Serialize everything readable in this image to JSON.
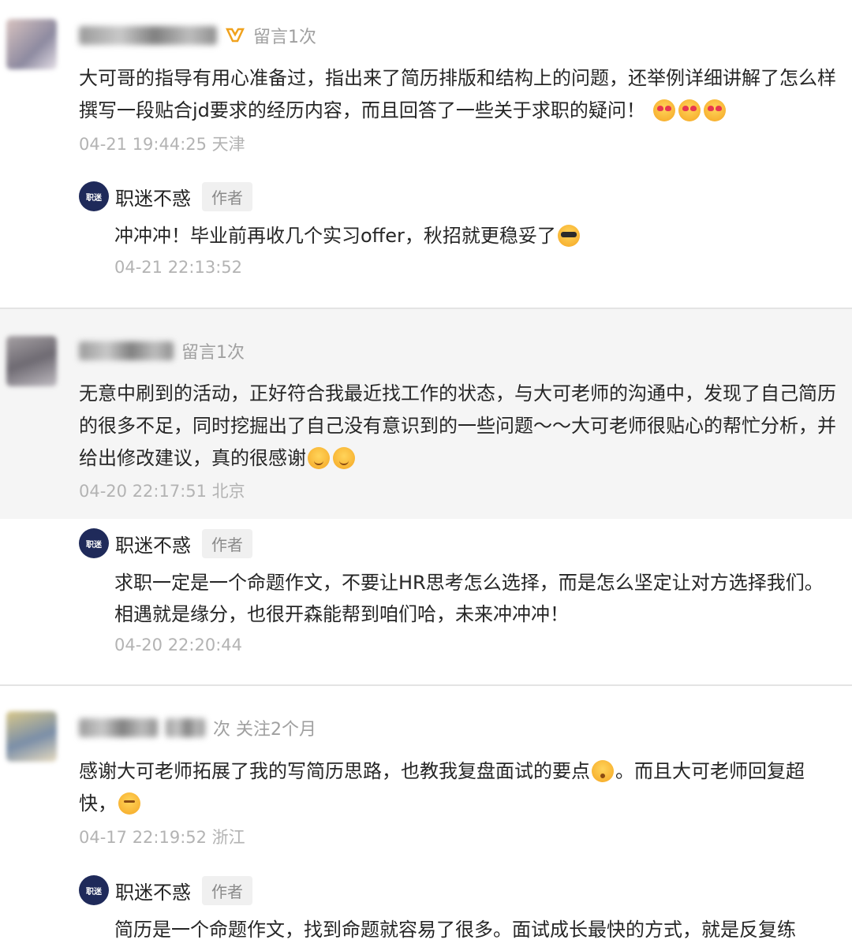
{
  "comments": [
    {
      "meta_text": "留言1次",
      "content": "大可哥的指导有用心准备过，指出来了简历排版和结构上的问题，还举例详细讲解了怎么样撰写一段贴合jd要求的经历内容，而且回答了一些关于求职的疑问！",
      "emojis": [
        "heart-eyes-emoji",
        "heart-eyes-emoji",
        "heart-eyes-emoji"
      ],
      "time": "04-21 19:44:25 天津",
      "reply": {
        "author": "职迷不惑",
        "tag": "作者",
        "content": "冲冲冲！毕业前再收几个实习offer，秋招就更稳妥了",
        "emoji": "sunglasses-emoji",
        "time": "04-21 22:13:52"
      }
    },
    {
      "meta_text": "留言1次",
      "content": "无意中刷到的活动，正好符合我最近找工作的状态，与大可老师的沟通中，发现了自己简历的很多不足，同时挖掘出了自己没有意识到的一些问题～～大可老师很贴心的帮忙分析，并给出修改建议，真的很感谢",
      "emojis": [
        "smile-emoji",
        "smile-emoji"
      ],
      "time": "04-20 22:17:51 北京",
      "reply": {
        "author": "职迷不惑",
        "tag": "作者",
        "content": "求职一定是一个命题作文，不要让HR思考怎么选择，而是怎么坚定让对方选择我们。相遇就是缘分，也很开森能帮到咱们哈，未来冲冲冲！",
        "time": "04-20 22:20:44"
      }
    },
    {
      "meta_text": "次 关注2个月",
      "content_a": "感谢大可老师拓展了我的写简历思路，也教我复盘面试的要点",
      "content_b": "。而且大可老师回复超快，",
      "time": "04-17 22:19:52 浙江",
      "reply": {
        "author": "职迷不惑",
        "tag": "作者",
        "content": "简历是一个命题作文，找到命题就容易了很多。面试成长最快的方式，就是反复练"
      }
    }
  ],
  "logo_text": "职迷",
  "colors": {
    "highlight_bg": "#f5f5f5",
    "logo_bg": "#1f2a5a",
    "time_text": "#b3b3b3",
    "meta_text": "#a0a0a0"
  }
}
